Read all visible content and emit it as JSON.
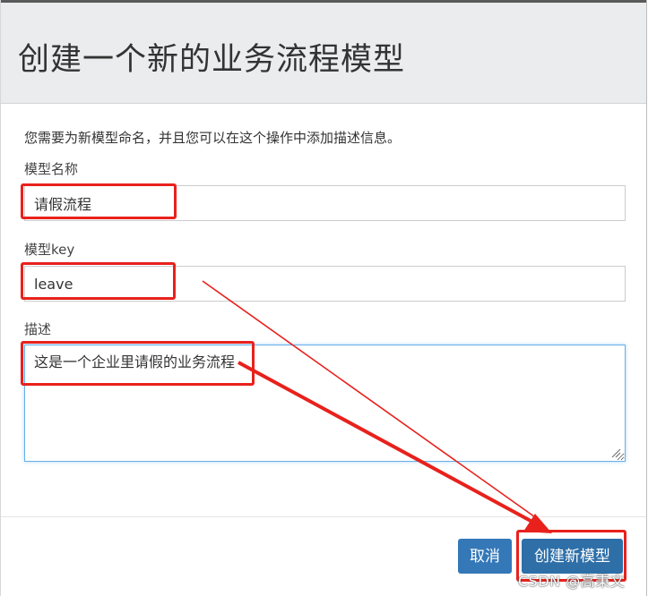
{
  "dialog": {
    "title": "创建一个新的业务流程模型",
    "intro": "您需要为新模型命名，并且您可以在这个操作中添加描述信息。"
  },
  "form": {
    "name_label": "模型名称",
    "name_value": "请假流程",
    "key_label": "模型key",
    "key_value": "leave",
    "desc_label": "描述",
    "desc_value": "这是一个企业里请假的业务流程"
  },
  "footer": {
    "cancel_label": "取消",
    "create_label": "创建新模型"
  },
  "watermark": "CSDN @高秉文",
  "colors": {
    "header_bg": "#eaecee",
    "primary_button": "#3478b8",
    "annotation": "#e8211c"
  }
}
